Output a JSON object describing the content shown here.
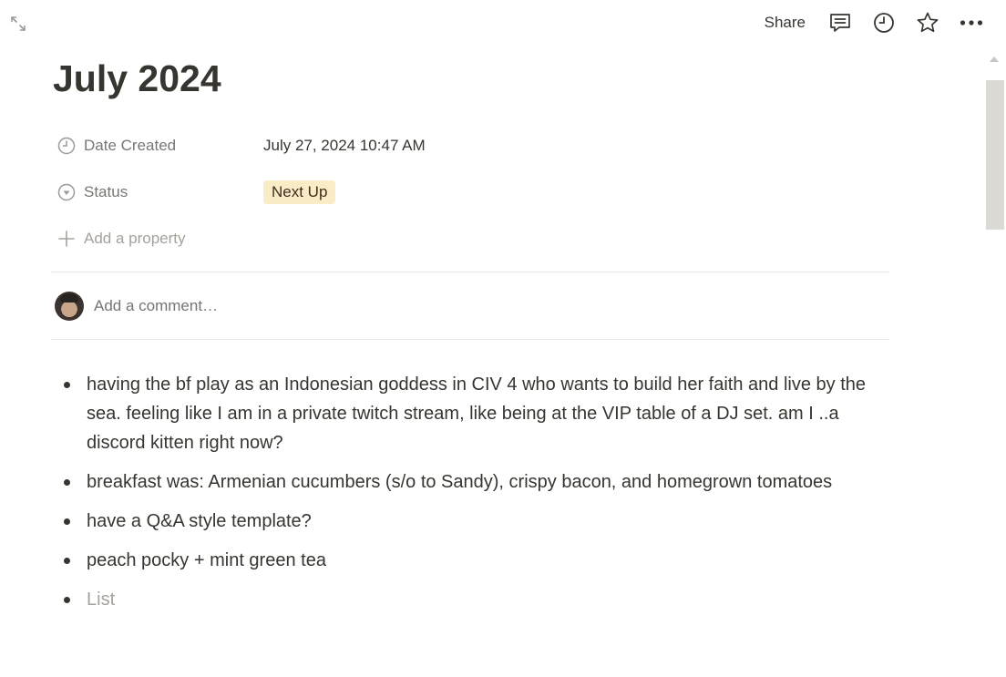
{
  "topbar": {
    "expand_icon": "expand-diagonal-icon",
    "share_label": "Share",
    "icons": [
      "comment-icon",
      "clock-icon",
      "star-icon",
      "more-icon"
    ]
  },
  "page": {
    "title": "July 2024",
    "properties": [
      {
        "icon": "clock-icon",
        "label": "Date Created",
        "value": "July 27, 2024 10:47 AM"
      },
      {
        "icon": "status-icon",
        "label": "Status",
        "value": "Next Up",
        "pill_color": "#fbecc8"
      }
    ],
    "add_property_label": "Add a property",
    "comment_placeholder": "Add a comment…",
    "bullets": [
      "having the bf play as an Indonesian goddess in CIV 4 who wants to build her faith and live by the sea. feeling like I am in a private twitch stream, like being at the VIP table of a DJ set. am I ..a discord kitten right now?",
      "breakfast was: Armenian cucumbers (s/o to Sandy), crispy bacon, and homegrown tomatoes",
      "have a Q&A style template?",
      "peach pocky + mint green tea"
    ],
    "bullet_placeholder": "List"
  }
}
